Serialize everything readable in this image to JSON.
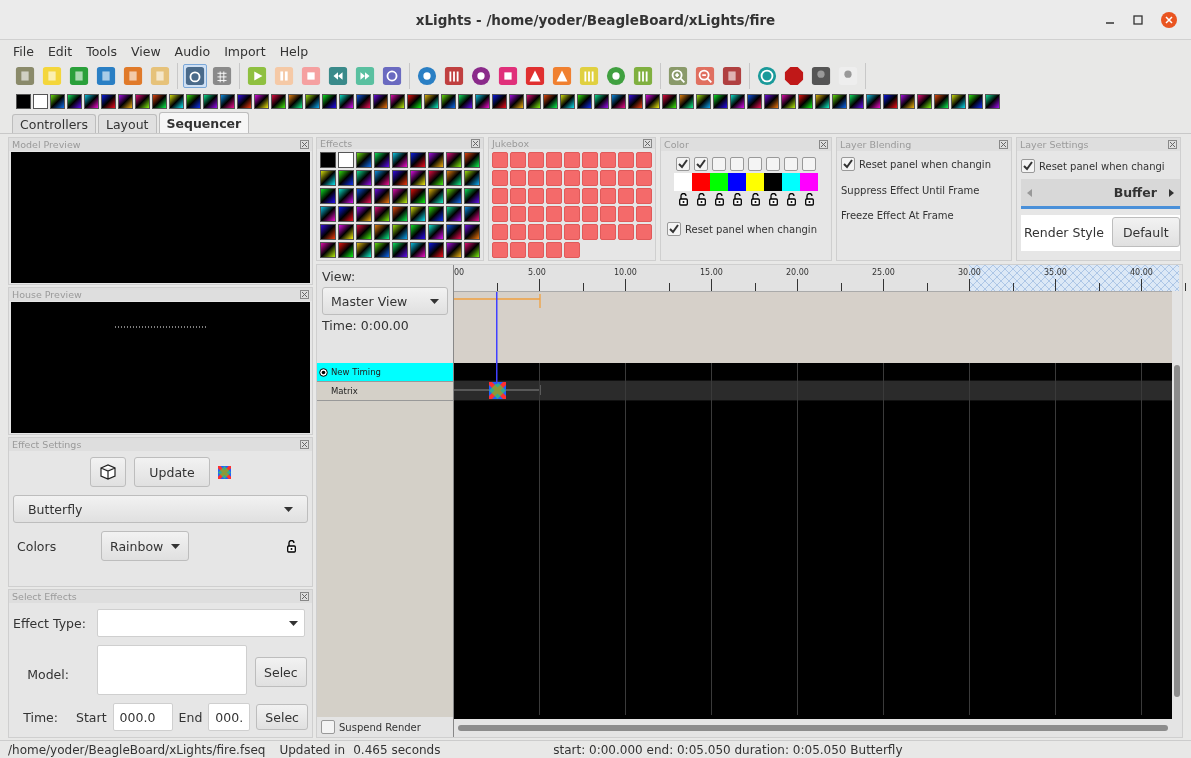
{
  "window": {
    "title": "xLights - /home/yoder/BeagleBoard/xLights/fire"
  },
  "menu": [
    "File",
    "Edit",
    "Tools",
    "View",
    "Audio",
    "Import",
    "Help"
  ],
  "tabs": [
    {
      "label": "Controllers",
      "selected": false
    },
    {
      "label": "Layout",
      "selected": false
    },
    {
      "label": "Sequencer",
      "selected": true
    }
  ],
  "model_preview": {
    "title": "Model Preview"
  },
  "house_preview": {
    "title": "House Preview"
  },
  "effect_settings": {
    "title": "Effect Settings",
    "update_button": "Update",
    "effect": "Butterfly",
    "colors_label": "Colors",
    "colors_value": "Rainbow"
  },
  "select_effects": {
    "title": "Select Effects",
    "effect_type_label": "Effect Type:",
    "model_label": "Model:",
    "select_button": "Selec",
    "time_label": "Time:",
    "start_label": "Start",
    "start_value": "000.0",
    "end_label": "End",
    "end_value": "000.",
    "time_select_button": "Selec"
  },
  "effects_panel": {
    "title": "Effects"
  },
  "jukebox": {
    "title": "Jukebox"
  },
  "color_panel": {
    "title": "Color",
    "swatches": [
      {
        "checked": true,
        "color": "#ffffff"
      },
      {
        "checked": true,
        "color": "#ff0000"
      },
      {
        "checked": false,
        "color": "#00ff00"
      },
      {
        "checked": false,
        "color": "#0000ff"
      },
      {
        "checked": false,
        "color": "#ffff00"
      },
      {
        "checked": false,
        "color": "#000000"
      },
      {
        "checked": false,
        "color": "#00ffff"
      },
      {
        "checked": false,
        "color": "#ff00ff"
      }
    ],
    "reset": {
      "label": "Reset panel when changin",
      "checked": true
    }
  },
  "layer_blending": {
    "title": "Layer Blending",
    "reset": {
      "label": "Reset panel when changin",
      "checked": true
    },
    "suppress_label": "Suppress Effect Until Frame",
    "freeze_label": "Freeze Effect At Frame"
  },
  "layer_settings": {
    "title": "Layer Settings",
    "reset": {
      "label": "Reset panel when changi",
      "checked": true
    },
    "tab": "Buffer",
    "render_style_label": "Render Style",
    "render_style_value": "Default"
  },
  "timeline": {
    "view_label": "View:",
    "view_value": "Master View",
    "time": "Time: 0:00.00",
    "ticks": [
      "00",
      "5.00",
      "10.00",
      "15.00",
      "20.00",
      "25.00",
      "30.00",
      "35.00",
      "40.00"
    ],
    "rows": [
      {
        "label": "New Timing",
        "kind": "timing",
        "selected": true
      },
      {
        "label": "Matrix",
        "kind": "model",
        "selected": false
      }
    ],
    "suspend_render": {
      "label": "Suspend Render",
      "checked": false
    }
  },
  "status_bar": {
    "path": "/home/yoder/BeagleBoard/xLights/fire.fseq",
    "updated": "Updated in",
    "duration": "0.465 seconds",
    "info": "start: 0:00.000 end: 0:05.050 duration: 0:05.050 Butterfly"
  }
}
